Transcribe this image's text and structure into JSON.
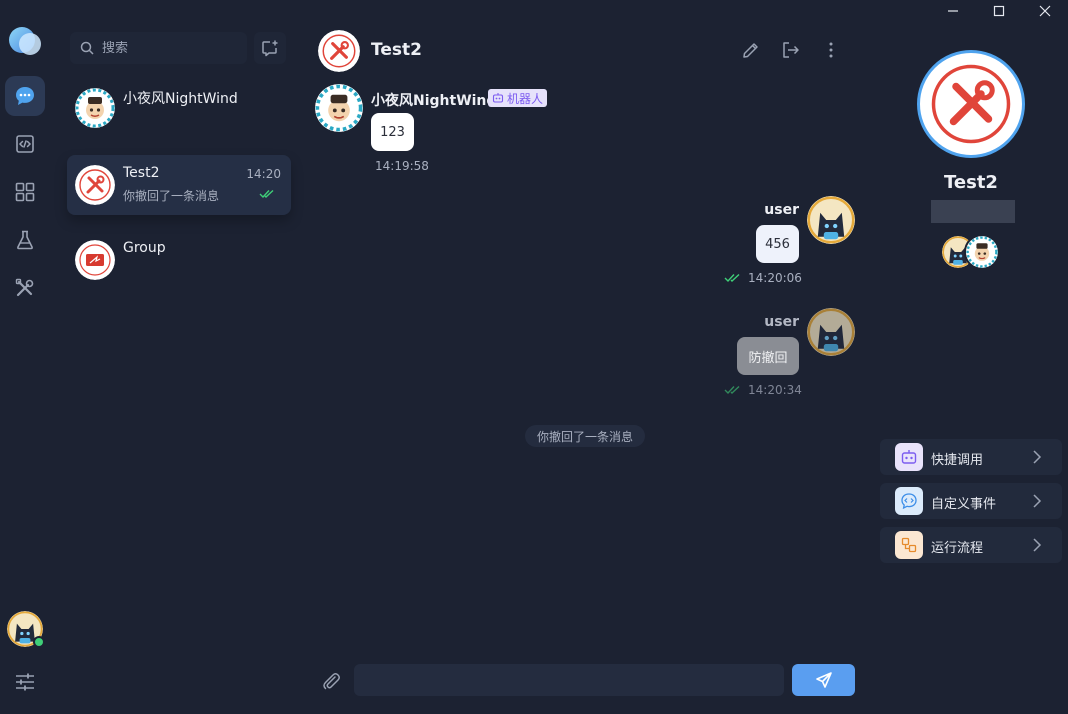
{
  "search": {
    "placeholder": "搜索"
  },
  "conversations": [
    {
      "name": "小夜风NightWind",
      "preview": "",
      "time": ""
    },
    {
      "name": "Test2",
      "preview": "你撤回了一条消息",
      "time": "14:20"
    },
    {
      "name": "Group",
      "preview": "",
      "time": ""
    }
  ],
  "chat": {
    "title": "Test2",
    "messages": [
      {
        "sender": "小夜风NightWind",
        "tag": "机器人",
        "text": "123",
        "time": "14:19:58"
      },
      {
        "sender": "user",
        "text": "456",
        "time": "14:20:06"
      },
      {
        "sender": "user",
        "text": "防撤回",
        "time": "14:20:34"
      }
    ],
    "system_note": "你撤回了一条消息",
    "composer_placeholder": ""
  },
  "panel": {
    "title": "Test2",
    "actions": [
      {
        "label": "快捷调用",
        "icon": "robot-icon",
        "color": "#7c5cf0"
      },
      {
        "label": "自定义事件",
        "icon": "code-chat-icon",
        "color": "#3d8ee8"
      },
      {
        "label": "运行流程",
        "icon": "flow-icon",
        "color": "#e58a2c"
      }
    ]
  },
  "colors": {
    "accent": "#5a9ef0",
    "active_nav": "#2c3a55",
    "online": "#3fcf78",
    "read_check": "#3fcf78",
    "bot_tag": "#7c5cf0"
  }
}
